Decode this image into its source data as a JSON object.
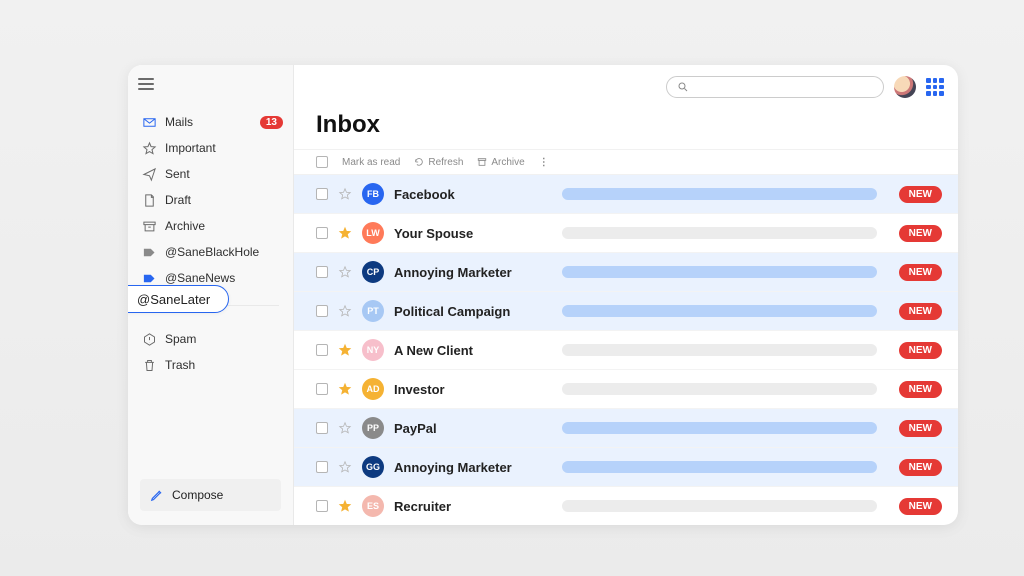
{
  "header": {
    "search_placeholder": "",
    "page_title": "Inbox"
  },
  "toolbar": {
    "mark_read": "Mark as read",
    "refresh": "Refresh",
    "archive": "Archive"
  },
  "compose_label": "Compose",
  "sidebar": {
    "items": [
      {
        "label": "Mails",
        "icon": "mail",
        "count": "13"
      },
      {
        "label": "Important",
        "icon": "star"
      },
      {
        "label": "Sent",
        "icon": "send"
      },
      {
        "label": "Draft",
        "icon": "draft"
      },
      {
        "label": "Archive",
        "icon": "archive"
      },
      {
        "label": "@SaneBlackHole",
        "icon": "tag-gray"
      },
      {
        "label": "@SaneLater",
        "icon": "tag-blue",
        "selected": true
      },
      {
        "label": "@SaneNews",
        "icon": "tag-blue"
      }
    ],
    "footer_items": [
      {
        "label": "Spam",
        "icon": "spam"
      },
      {
        "label": "Trash",
        "icon": "trash"
      }
    ]
  },
  "messages": [
    {
      "initials": "FB",
      "avatar_color": "#2866f0",
      "sender": "Facebook",
      "starred": false,
      "highlight": true,
      "badge": "NEW"
    },
    {
      "initials": "LW",
      "avatar_color": "#ff7a59",
      "sender": "Your Spouse",
      "starred": true,
      "highlight": false,
      "badge": "NEW"
    },
    {
      "initials": "CP",
      "avatar_color": "#0d3a80",
      "sender": "Annoying Marketer",
      "starred": false,
      "highlight": true,
      "badge": "NEW"
    },
    {
      "initials": "PT",
      "avatar_color": "#a7c8f4",
      "sender": "Political Campaign",
      "starred": false,
      "highlight": true,
      "badge": "NEW"
    },
    {
      "initials": "NY",
      "avatar_color": "#f7bfcb",
      "sender": "A New Client",
      "starred": true,
      "highlight": false,
      "badge": "NEW"
    },
    {
      "initials": "AD",
      "avatar_color": "#f5b233",
      "sender": "Investor",
      "starred": true,
      "highlight": false,
      "badge": "NEW"
    },
    {
      "initials": "PP",
      "avatar_color": "#8a8a8a",
      "sender": "PayPal",
      "starred": false,
      "highlight": true,
      "badge": "NEW"
    },
    {
      "initials": "GG",
      "avatar_color": "#0d3a80",
      "sender": "Annoying Marketer",
      "starred": false,
      "highlight": true,
      "badge": "NEW"
    },
    {
      "initials": "ES",
      "avatar_color": "#f4b8ae",
      "sender": "Recruiter",
      "starred": true,
      "highlight": false,
      "badge": "NEW"
    }
  ],
  "colors": {
    "accent": "#2866f0",
    "danger": "#e53935"
  }
}
